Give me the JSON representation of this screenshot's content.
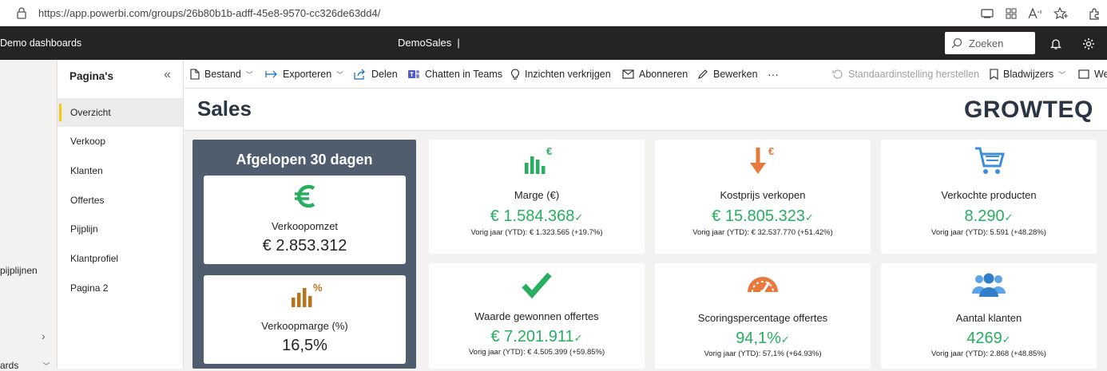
{
  "browser": {
    "url": "https://app.powerbi.com/groups/26b80b1b-adff-45e8-9570-cc326de63dd4/"
  },
  "topbar": {
    "app_name": "Demo dashboards",
    "report_name": "DemoSales",
    "search_placeholder": "Zoeken"
  },
  "leftnav": {
    "item_pipelines": "pijplijnen",
    "item_dashboards": "ards"
  },
  "pages_pane": {
    "title": "Pagina's",
    "items": [
      "Overzicht",
      "Verkoop",
      "Klanten",
      "Offertes",
      "Pijplijn",
      "Klantprofiel",
      "Pagina 2"
    ],
    "selected": "Overzicht"
  },
  "toolbar": {
    "file": "Bestand",
    "export": "Exporteren",
    "share": "Delen",
    "teams": "Chatten in Teams",
    "insights": "Inzichten verkrijgen",
    "subscribe": "Abonneren",
    "edit": "Bewerken",
    "more": "···",
    "reset": "Standaardinstelling herstellen",
    "bookmarks": "Bladwijzers",
    "view": "We"
  },
  "report": {
    "title": "Sales",
    "logo": "GROWTEQ",
    "period_title": "Afgelopen 30 dagen",
    "period_cards": [
      {
        "label": "Verkoopomzet",
        "value": "€ 2.853.312",
        "icon": "euro-icon"
      },
      {
        "label": "Verkoopmarge (%)",
        "value": "16,5%",
        "icon": "bar-chart-percent-icon"
      }
    ],
    "kpis": [
      {
        "label": "Marge (€)",
        "value": "€ 1.584.368",
        "sub": "Vorig jaar (YTD): € 1.323.565 (+19.7%)",
        "icon": "bar-chart-euro-icon"
      },
      {
        "label": "Kostprijs verkopen",
        "value": "€ 15.805.323",
        "sub": "Vorig jaar (YTD): € 32.537.770 (+51.42%)",
        "icon": "cost-arrow-icon"
      },
      {
        "label": "Verkochte producten",
        "value": "8.290",
        "sub": "Vorig jaar (YTD): 5.591 (+48.28%)",
        "icon": "cart-icon"
      },
      {
        "label": "Waarde gewonnen offertes",
        "value": "€ 7.201.911",
        "sub": "Vorig jaar (YTD): € 4.505.399 (+59.85%)",
        "icon": "checkmark-icon"
      },
      {
        "label": "Scoringspercentage offertes",
        "value": "94,1%",
        "sub": "Vorig jaar (YTD): 57,1% (+64.93%)",
        "icon": "gauge-icon"
      },
      {
        "label": "Aantal klanten",
        "value": "4269",
        "sub": "Vorig jaar (YTD): 2.868 (+48.85%)",
        "icon": "customers-icon"
      }
    ],
    "check_glyph": "✓"
  },
  "colors": {
    "accent_green": "#27ae60",
    "accent_orange": "#e8793d",
    "accent_blue": "#3b8fd6",
    "accent_brown": "#b8741a",
    "panel_slate": "#505d6e",
    "topbar": "#252423"
  }
}
